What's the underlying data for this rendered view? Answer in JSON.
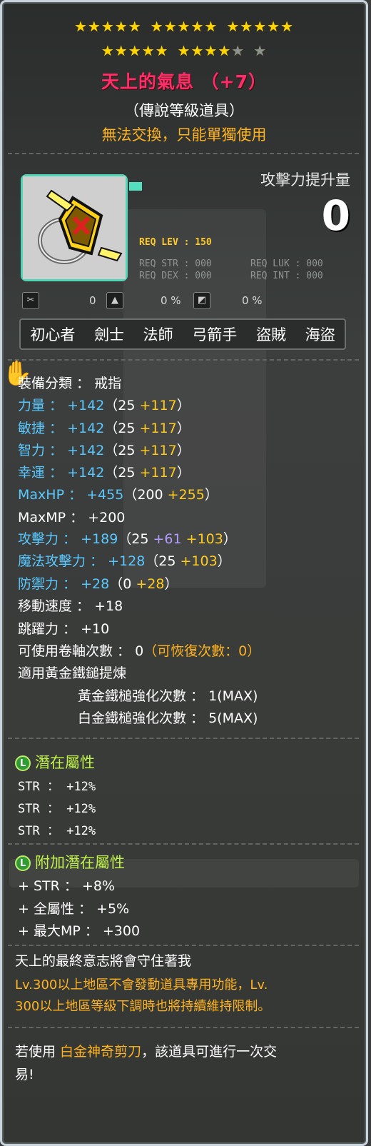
{
  "stars": {
    "row1_filled": 15,
    "row2_filled": 9,
    "row2_empty": 2
  },
  "item": {
    "name": "天上的氣息 （+7）",
    "grade": "（傳說等級道具）",
    "trade": "無法交換，只能單獨使用",
    "icon": "heart-shield-ring-icon"
  },
  "attack_gain": {
    "label": "攻擊力提升量",
    "value": "0"
  },
  "requirements": {
    "lev": "REQ LEV : 150",
    "str": "REQ STR : 000",
    "luk": "REQ LUK : 000",
    "dex": "REQ DEX : 000",
    "int": "REQ INT : 000"
  },
  "misc_icons": {
    "a_val": "0",
    "b_val": "0 %",
    "c_val": "0 %"
  },
  "jobs": [
    "初心者",
    "劍士",
    "法師",
    "弓箭手",
    "盜賊",
    "海盜"
  ],
  "stats": {
    "category": "裝備分類 ： 戒指",
    "str": {
      "label": "力量 ：",
      "total": "+142",
      "base": "（25",
      "bonus": "+117",
      "end": "）"
    },
    "dex": {
      "label": "敏捷 ：",
      "total": "+142",
      "base": "（25",
      "bonus": "+117",
      "end": "）"
    },
    "int": {
      "label": "智力 ：",
      "total": "+142",
      "base": "（25",
      "bonus": "+117",
      "end": "）"
    },
    "luk": {
      "label": "幸運 ：",
      "total": "+142",
      "base": "（25",
      "bonus": "+117",
      "end": "）"
    },
    "maxhp": {
      "label": "MaxHP ：",
      "total": "+455",
      "base": "（200",
      "bonus": "+255",
      "end": "）"
    },
    "maxmp": "MaxMP ： +200",
    "atk": {
      "label": "攻擊力 ：",
      "total": "+189",
      "base": "（25",
      "extra": "+61",
      "bonus": "+103",
      "end": "）"
    },
    "matk": {
      "label": "魔法攻擊力 ：",
      "total": "+128",
      "base": "（25",
      "bonus": "+103",
      "end": "）"
    },
    "def": {
      "label": "防禦力 ：",
      "total": "+28",
      "base": "（0",
      "bonus": "+28",
      "end": "）"
    },
    "speed": "移動速度 ： +18",
    "jump": "跳躍力 ： +10",
    "scroll": "可使用卷軸次數 ： 0",
    "scroll_restore": "（可恢復次數：0）",
    "hammer_title": "適用黃金鐵鎚提煉",
    "gold_hammer": "黃金鐵槌強化次數 ： 1(MAX)",
    "plat_hammer": "白金鐵槌強化次數 ： 5(MAX)"
  },
  "potential": {
    "title": "潛在屬性",
    "lines": [
      "STR ： +12%",
      "STR ： +12%",
      "STR ： +12%"
    ]
  },
  "bonus_potential": {
    "title": "附加潛在屬性",
    "lines": [
      "+ STR ： +8%",
      "+ 全屬性 ： +5%",
      "+ 最大MP ： +300"
    ]
  },
  "description": {
    "line1": "天上的最終意志將會守住著我",
    "line2": "Lv.300以上地區不會發動道具專用功能，Lv.",
    "line3": "300以上地區等級下調時也將持續維持限制。",
    "line4_a": "若使用 ",
    "line4_b": "白金神奇剪刀",
    "line4_c": "，該道具可進行一次交",
    "line5": "易!"
  },
  "colors": {
    "title": "#ff2d6c",
    "cyan": "#59c8ff",
    "yellow": "#ffcc1e",
    "orange": "#ffb31f",
    "green": "#bff24a"
  }
}
